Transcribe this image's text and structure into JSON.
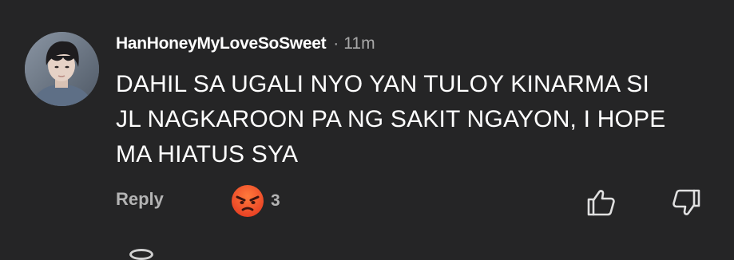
{
  "comment": {
    "username": "HanHoneyMyLoveSoSweet",
    "separator": "·",
    "time": "11m",
    "text_lines": [
      "DAHIL SA UGALI NYO YAN TULOY KINARMA SI",
      "JL NAGKAROON PA NG SAKIT NGAYON, I HOPE",
      "MA HIATUS SYA"
    ],
    "reply_label": "Reply",
    "reaction": {
      "icon": "angry-face-icon",
      "count": "3"
    },
    "like_icon": "thumbs-up-icon",
    "dislike_icon": "thumbs-down-icon"
  },
  "colors": {
    "background": "#252526",
    "primary_text": "#ffffff",
    "secondary_text": "#b4b4b4",
    "angry_face": "#f2562b"
  }
}
